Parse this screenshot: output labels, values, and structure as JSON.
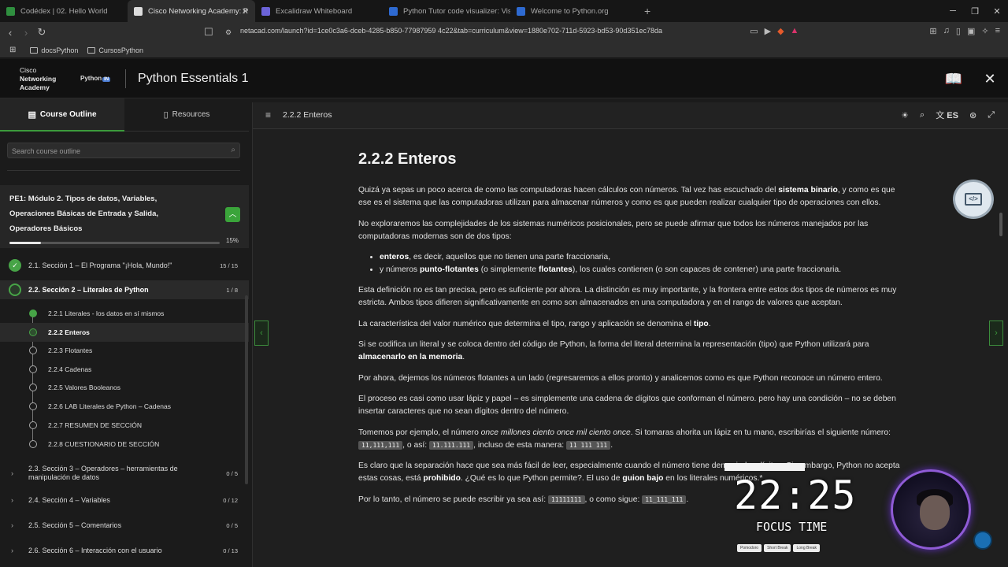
{
  "browser": {
    "tabs": [
      {
        "title": "Codédex | 02. Hello World",
        "color": "#2f8f3f",
        "active": false
      },
      {
        "title": "Cisco Networking Academy: P",
        "color": "#dddddd",
        "active": true
      },
      {
        "title": "Excalidraw Whiteboard",
        "color": "#6b63d8",
        "active": false
      },
      {
        "title": "Python Tutor code visualizer: Visu",
        "color": "#2e6ad1",
        "active": false
      },
      {
        "title": "Welcome to Python.org",
        "color": "#2e6ad1",
        "active": false
      }
    ],
    "url": "netacad.com/launch?id=1ce0c3a6-dceb-4285-b850-77987959 4c22&tab=curriculum&view=1880e702-711d-5923-bd53-90d351ec78da",
    "bookmarks": [
      "docsPython",
      "CursosPython"
    ]
  },
  "app": {
    "brand_line1": "Cisco",
    "brand_line2": "Networking",
    "brand_line3": "Academy",
    "python_institute": "Python",
    "python_institute_badge": "IN",
    "course_title": "Python Essentials 1"
  },
  "sidebar": {
    "tab_outline": "Course Outline",
    "tab_resources": "Resources",
    "search_placeholder": "Search course outline",
    "module_title": "PE1: Módulo 2. Tipos de datos, Variables, Operaciones Básicas de Entrada y Salida, Operadores Básicos",
    "module_progress": 15,
    "module_progress_label": "15%",
    "sections": [
      {
        "label": "2.1. Sección 1 – El Programa \"¡Hola, Mundo!\"",
        "count": "15 / 15"
      },
      {
        "label": "2.2. Sección 2 – Literales de Python",
        "count": "1 / 8"
      },
      {
        "label": "2.3. Sección 3 – Operadores – herramientas de manipulación de datos",
        "count": "0 / 5"
      },
      {
        "label": "2.4. Sección 4 – Variables",
        "count": "0 / 12"
      },
      {
        "label": "2.5. Sección 5 – Comentarios",
        "count": "0 / 5"
      },
      {
        "label": "2.6. Sección 6 – Interacción con el usuario",
        "count": "0 / 13"
      }
    ],
    "subitems": [
      {
        "label": "2.2.1 Literales - los datos en sí mismos"
      },
      {
        "label": "2.2.2 Enteros"
      },
      {
        "label": "2.2.3 Flotantes"
      },
      {
        "label": "2.2.4 Cadenas"
      },
      {
        "label": "2.2.5 Valores Booleanos"
      },
      {
        "label": "2.2.6 LAB Literales de Python – Cadenas"
      },
      {
        "label": "2.2.7 RESUMEN DE SECCIÓN"
      },
      {
        "label": "2.2.8 CUESTIONARIO DE SECCIÓN"
      }
    ]
  },
  "content": {
    "topbar_title": "2.2.2 Enteros",
    "lang": "ES",
    "heading": "2.2.2 Enteros",
    "p1_a": "Quizá ya sepas un poco acerca de como las computadoras hacen cálculos con números. Tal vez has escuchado del ",
    "p1_b": "sistema binario",
    "p1_c": ", y como es que ese es el sistema que las computadoras utilizan para almacenar números y como es que pueden realizar cualquier tipo de operaciones con ellos.",
    "p2": "No exploraremos las complejidades de los sistemas numéricos posicionales, pero se puede afirmar que todos los números manejados por las computadoras modernas son de dos tipos:",
    "li1_a": "enteros",
    "li1_b": ", es decir, aquellos que no tienen una parte fraccionaria,",
    "li2_a": "y números ",
    "li2_b": "punto-flotantes",
    "li2_c": " (o simplemente ",
    "li2_d": "flotantes",
    "li2_e": "), los cuales contienen (o son capaces de contener) una parte fraccionaria.",
    "p3": "Esta definición no es tan precisa, pero es suficiente por ahora. La distinción es muy importante, y la frontera entre estos dos tipos de números es muy estricta. Ambos tipos difieren significativamente en como son almacenados en una computadora y en el rango de valores que aceptan.",
    "p4_a": "La característica del valor numérico que determina el tipo, rango y aplicación se denomina el ",
    "p4_b": "tipo",
    "p4_c": ".",
    "p5_a": "Si se codifica un literal y se coloca dentro del código de Python, la forma del literal determina la representación (tipo) que Python utilizará para ",
    "p5_b": "almacenarlo en la memoria",
    "p5_c": ".",
    "p6": "Por ahora, dejemos los números flotantes a un lado (regresaremos a ellos pronto) y analicemos como es que Python reconoce un número entero.",
    "p7": "El proceso es casi como usar lápiz y papel – es simplemente una cadena de dígitos que conforman el número. pero hay una condición – no se deben insertar caracteres que no sean dígitos dentro del número.",
    "p8_a": "Tomemos por ejemplo, el número ",
    "p8_b": "once millones ciento once mil ciento once",
    "p8_c": ". Si tomaras ahorita un lápiz en tu mano, escribirías el siguiente número: ",
    "p8_code1": "11,111,111",
    "p8_d": ", o así: ",
    "p8_code2": "11.111.111",
    "p8_e": ", incluso de esta manera: ",
    "p8_code3": "11 111 111",
    "p8_f": ".",
    "p9_a": "Es claro que la separación hace que sea más fácil de leer, especialmente cuando el número tiene demasiados dígitos. Sin embargo, Python no acepta estas cosas, está ",
    "p9_b": "prohibido",
    "p9_c": ". ¿Qué es lo que Python permite?. El uso de ",
    "p9_d": "guion bajo",
    "p9_e": " en los literales numéricos.*",
    "p10_a": "Por lo tanto, el número se puede escribir ya sea así: ",
    "p10_code1": "11111111",
    "p10_b": ", o como sigue: ",
    "p10_code2": "11_111_111",
    "p10_c": "."
  },
  "overlay": {
    "time": "22:25",
    "label": "FOCUS TIME",
    "modes": [
      "Pomodoro",
      "Short Break",
      "Long Break"
    ]
  }
}
